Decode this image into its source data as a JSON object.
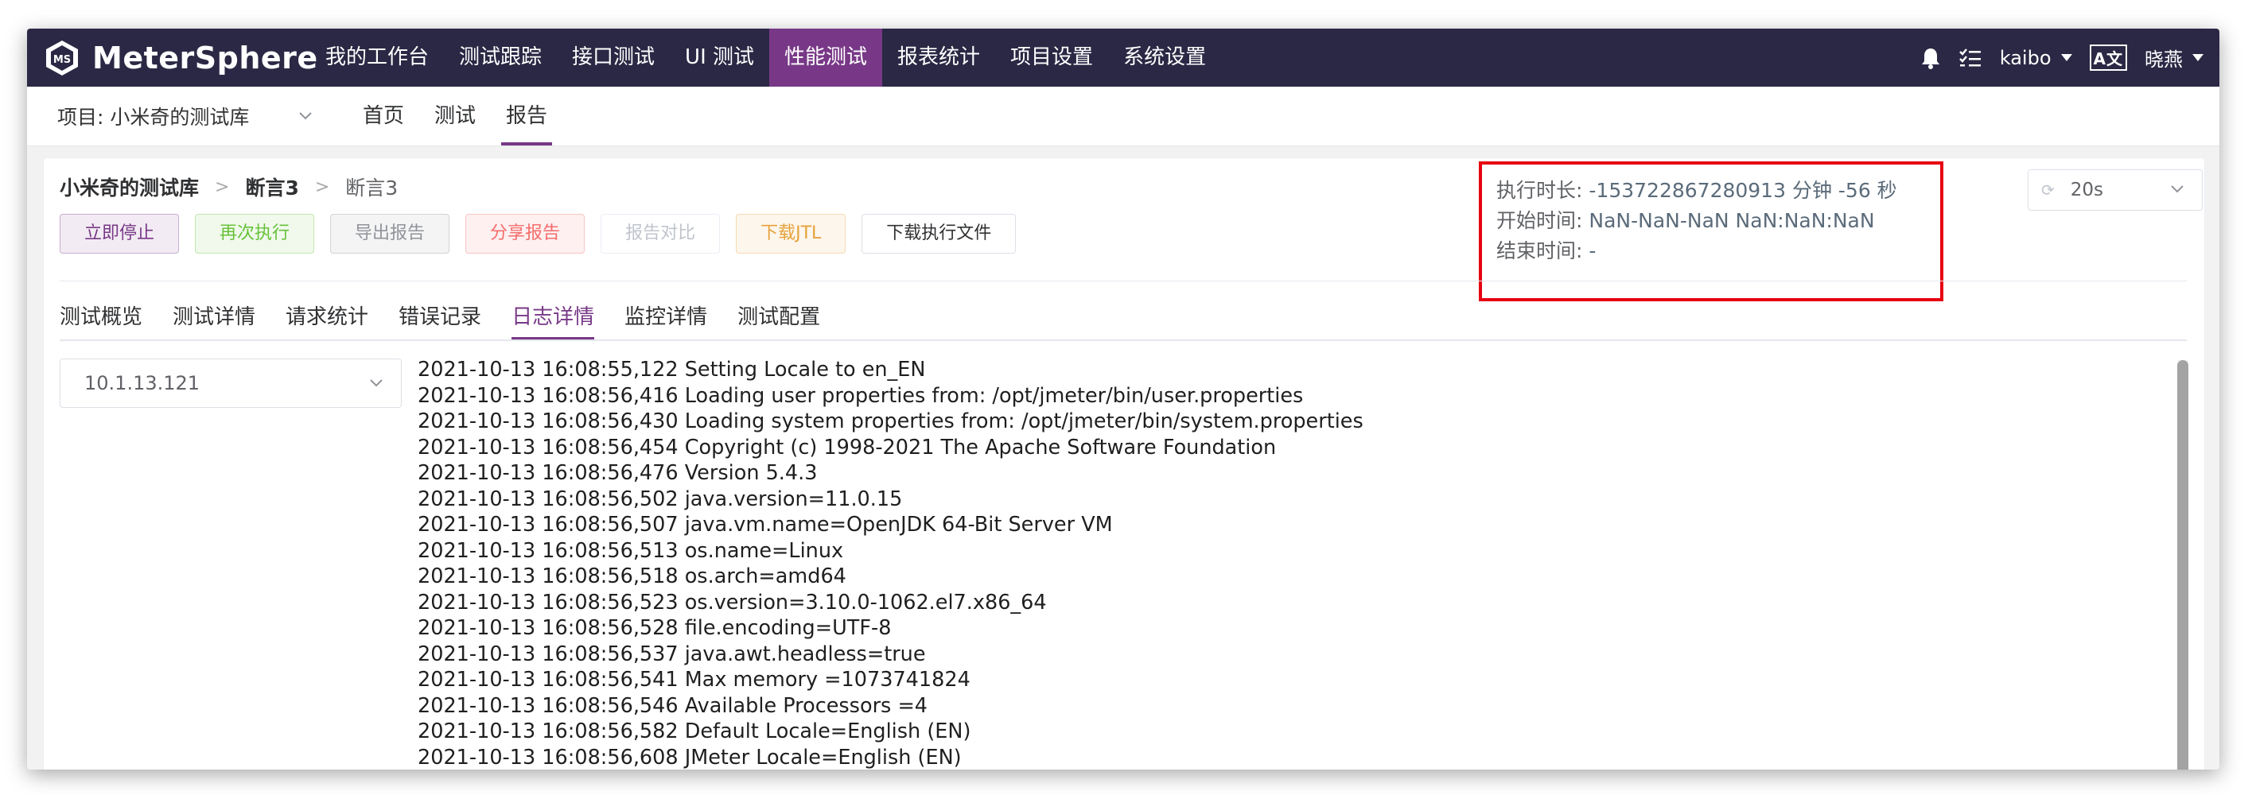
{
  "app": {
    "logo_text": "MeterSphere",
    "brand_color": "#2a2844",
    "accent_color": "#783887"
  },
  "topnav": {
    "items": [
      "我的工作台",
      "测试跟踪",
      "接口测试",
      "UI 测试",
      "性能测试",
      "报表统计",
      "项目设置",
      "系统设置"
    ],
    "active": "性能测试",
    "user": "kaibo",
    "lang_icon": "A文",
    "workspace": "晓燕"
  },
  "subnav": {
    "project_label": "项目: 小米奇的测试库",
    "tabs": [
      "首页",
      "测试",
      "报告"
    ],
    "active": "报告"
  },
  "breadcrumb": [
    "小米奇的测试库",
    "断言3",
    "断言3"
  ],
  "buttons": {
    "stop": "立即停止",
    "rerun": "再次执行",
    "export": "导出报告",
    "share": "分享报告",
    "compare": "报告对比",
    "download_jtl": "下载JTL",
    "download_file": "下载执行文件"
  },
  "info": {
    "duration_label": "执行时长:",
    "duration_value": "-153722867280913 分钟 -56 秒",
    "start_label": "开始时间:",
    "start_value": "NaN-NaN-NaN NaN:NaN:NaN",
    "end_label": "结束时间:",
    "end_value": "-"
  },
  "refresh": {
    "value": "20s"
  },
  "tabs": {
    "items": [
      "测试概览",
      "测试详情",
      "请求统计",
      "错误记录",
      "日志详情",
      "监控详情",
      "测试配置"
    ],
    "active": "日志详情"
  },
  "log": {
    "host_selected": "10.1.13.121",
    "lines": [
      "2021-10-13 16:08:55,122 Setting Locale to en_EN",
      "2021-10-13 16:08:56,416 Loading user properties from: /opt/jmeter/bin/user.properties",
      "2021-10-13 16:08:56,430 Loading system properties from: /opt/jmeter/bin/system.properties",
      "2021-10-13 16:08:56,454 Copyright (c) 1998-2021 The Apache Software Foundation",
      "2021-10-13 16:08:56,476 Version 5.4.3",
      "2021-10-13 16:08:56,502 java.version=11.0.15",
      "2021-10-13 16:08:56,507 java.vm.name=OpenJDK 64-Bit Server VM",
      "2021-10-13 16:08:56,513 os.name=Linux",
      "2021-10-13 16:08:56,518 os.arch=amd64",
      "2021-10-13 16:08:56,523 os.version=3.10.0-1062.el7.x86_64",
      "2021-10-13 16:08:56,528 file.encoding=UTF-8",
      "2021-10-13 16:08:56,537 java.awt.headless=true",
      "2021-10-13 16:08:56,541 Max memory =1073741824",
      "2021-10-13 16:08:56,546 Available Processors =4",
      "2021-10-13 16:08:56,582 Default Locale=English (EN)",
      "2021-10-13 16:08:56,608 JMeter Locale=English (EN)"
    ]
  }
}
